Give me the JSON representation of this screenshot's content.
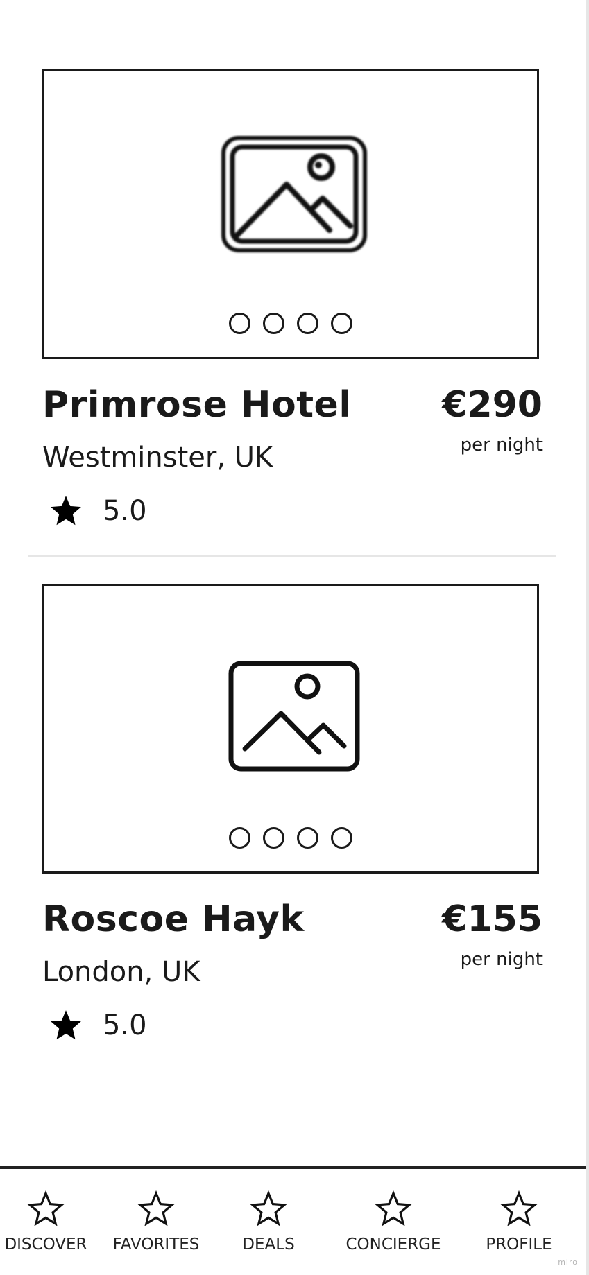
{
  "listings": [
    {
      "name": "Primrose Hotel",
      "location": "Westminster, UK",
      "price": "€290",
      "price_unit": "per night",
      "rating": "5.0",
      "photo_icon": "image-placeholder-icon",
      "carousel_dots": 4
    },
    {
      "name": "Roscoe Hayk",
      "location": "London, UK",
      "price": "€155",
      "price_unit": "per night",
      "rating": "5.0",
      "photo_icon": "image-placeholder-icon",
      "carousel_dots": 4
    }
  ],
  "nav": {
    "items": [
      {
        "label": "DISCOVER",
        "icon": "star-outline-icon"
      },
      {
        "label": "FAVORITES",
        "icon": "star-outline-icon"
      },
      {
        "label": "DEALS",
        "icon": "star-outline-icon"
      },
      {
        "label": "CONCIERGE",
        "icon": "star-outline-icon"
      },
      {
        "label": "PROFILE",
        "icon": "star-outline-icon"
      }
    ]
  },
  "watermark": "miro",
  "colors": {
    "ink": "#1a1a1a",
    "divider": "#e6e6e6",
    "background": "#ffffff"
  }
}
